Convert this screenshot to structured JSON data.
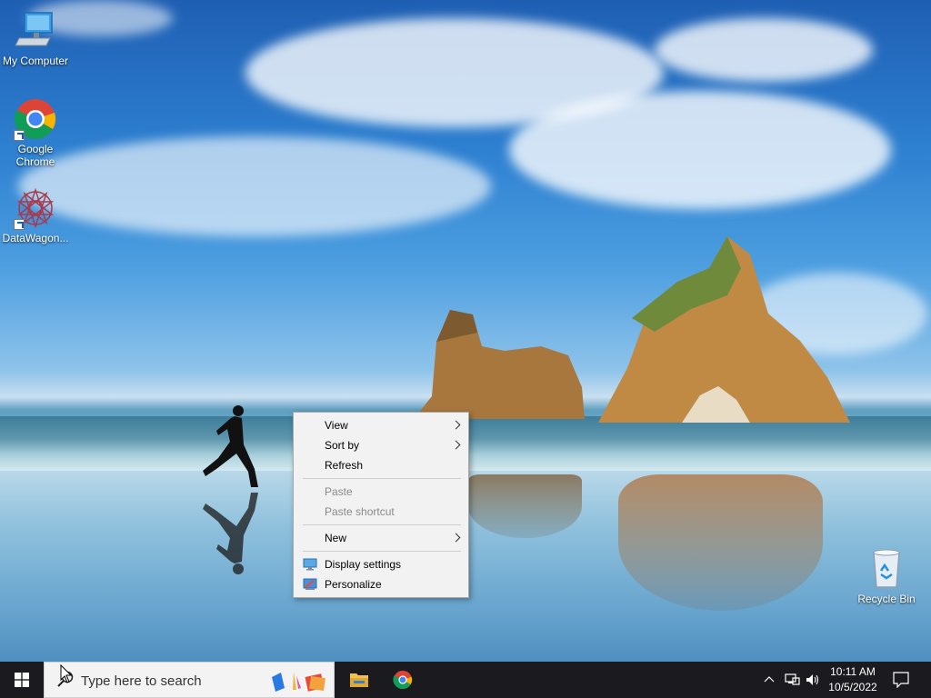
{
  "desktop": {
    "icons": [
      {
        "label": "My Computer",
        "icon": "computer-icon"
      },
      {
        "label": "Google Chrome",
        "icon": "chrome-icon"
      },
      {
        "label": "DataWagon...",
        "icon": "datawagon-icon"
      },
      {
        "label": "Recycle Bin",
        "icon": "recycle-bin-icon"
      }
    ]
  },
  "context_menu": {
    "items": [
      {
        "label": "View",
        "submenu": true,
        "enabled": true
      },
      {
        "label": "Sort by",
        "submenu": true,
        "enabled": true
      },
      {
        "label": "Refresh",
        "submenu": false,
        "enabled": true
      },
      {
        "label": "Paste",
        "submenu": false,
        "enabled": false
      },
      {
        "label": "Paste shortcut",
        "submenu": false,
        "enabled": false
      },
      {
        "label": "New",
        "submenu": true,
        "enabled": true
      },
      {
        "label": "Display settings",
        "icon": "display-icon",
        "enabled": true
      },
      {
        "label": "Personalize",
        "icon": "personalize-icon",
        "enabled": true
      }
    ]
  },
  "taskbar": {
    "search_placeholder": "Type here to search",
    "pinned": [
      {
        "name": "File Explorer",
        "icon": "folder-icon"
      },
      {
        "name": "Google Chrome",
        "icon": "chrome-icon"
      }
    ],
    "clock": {
      "time": "10:11 AM",
      "date": "10/5/2022"
    }
  },
  "colors": {
    "taskbar": "#1b1b1f",
    "menu_bg": "#f2f2f2",
    "accent": "#1a73e8"
  }
}
